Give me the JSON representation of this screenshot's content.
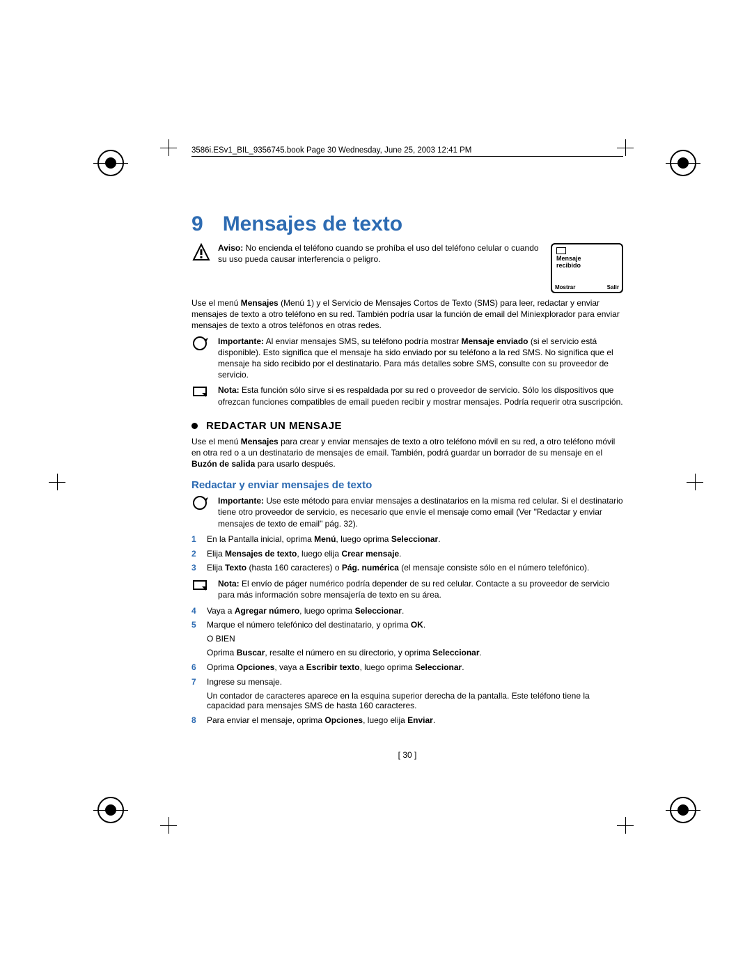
{
  "header": "3586i.ESv1_BIL_9356745.book  Page 30  Wednesday, June 25, 2003  12:41 PM",
  "chapter": {
    "num": "9",
    "title": "Mensajes de texto"
  },
  "aviso": {
    "label": "Aviso:",
    "text": " No encienda el teléfono cuando se prohíba el uso del teléfono celular o cuando su uso pueda causar interferencia o peligro."
  },
  "phone": {
    "line1": "Mensaje",
    "line2": "recibido",
    "left": "Mostrar",
    "right": "Salir"
  },
  "intro1_a": "Use el menú ",
  "intro1_b": "Mensajes",
  "intro1_c": " (Menú 1) y el Servicio de Mensajes Cortos de Texto (SMS) para leer, redactar y enviar mensajes de texto a otro teléfono en su red. También podría usar la función de email del Miniexplorador para enviar mensajes de texto a otros teléfonos en otras redes.",
  "important1_label": "Importante:",
  "important1_a": " Al enviar mensajes SMS, su teléfono podría mostrar ",
  "important1_b": "Mensaje enviado",
  "important1_c": " (si el servicio está disponible). Esto significa que el mensaje ha sido enviado por su teléfono a la red SMS. No significa que el mensaje ha sido recibido por el destinatario. Para más detalles sobre SMS, consulte con su proveedor de servicio.",
  "nota1_label": "Nota:",
  "nota1_text": " Esta función sólo sirve si es respaldada por su red o proveedor de servicio. Sólo los dispositivos que ofrezcan funciones compatibles de email pueden recibir y mostrar mensajes. Podría requerir otra suscripción.",
  "section1": "REDACTAR UN MENSAJE",
  "section1_a": "Use el menú ",
  "section1_b": "Mensajes",
  "section1_c": " para crear y enviar mensajes de texto a otro teléfono móvil en su red, a otro teléfono móvil en otra red o a un destinatario de mensajes de email. También, podrá guardar un borrador de su mensaje en el ",
  "section1_d": "Buzón de salida",
  "section1_e": " para usarlo después.",
  "subsection1": "Redactar y enviar mensajes de texto",
  "important2_label": "Importante:",
  "important2_text": " Use este método para enviar mensajes a destinatarios en la misma red celular. Si el destinatario tiene otro proveedor de servicio, es necesario que envíe el mensaje como email (Ver \"Redactar y enviar mensajes de texto de email\" pág. 32).",
  "steps": {
    "s1_a": "En la Pantalla inicial, oprima ",
    "s1_b": "Menú",
    "s1_c": ", luego oprima ",
    "s1_d": "Seleccionar",
    "s1_e": ".",
    "s2_a": "Elija ",
    "s2_b": "Mensajes de texto",
    "s2_c": ", luego elija ",
    "s2_d": "Crear mensaje",
    "s2_e": ".",
    "s3_a": "Elija ",
    "s3_b": "Texto",
    "s3_c": " (hasta 160 caracteres) o ",
    "s3_d": "Pág. numérica",
    "s3_e": " (el mensaje consiste sólo en el número telefónico).",
    "nota2_label": "Nota:",
    "nota2_text": " El envío de páger numérico podría depender de su red celular. Contacte a su proveedor de servicio para más información sobre mensajería de texto en su área.",
    "s4_a": "Vaya a ",
    "s4_b": "Agregar número",
    "s4_c": ", luego oprima ",
    "s4_d": "Seleccionar",
    "s4_e": ".",
    "s5_a": "Marque el número telefónico del destinatario, y oprima ",
    "s5_b": "OK",
    "s5_c": ".",
    "s5_sub1": "O BIEN",
    "s5_sub2_a": "Oprima ",
    "s5_sub2_b": "Buscar",
    "s5_sub2_c": ", resalte el número en su directorio, y oprima ",
    "s5_sub2_d": "Seleccionar",
    "s5_sub2_e": ".",
    "s6_a": "Oprima ",
    "s6_b": "Opciones",
    "s6_c": ", vaya a ",
    "s6_d": "Escribir texto",
    "s6_e": ", luego oprima ",
    "s6_f": "Seleccionar",
    "s6_g": ".",
    "s7": "Ingrese su mensaje.",
    "s7_sub": "Un contador de caracteres aparece en la esquina superior derecha de la pantalla. Este teléfono tiene la capacidad para mensajes SMS de hasta 160 caracteres.",
    "s8_a": "Para enviar el mensaje, oprima ",
    "s8_b": "Opciones",
    "s8_c": ", luego elija ",
    "s8_d": "Enviar",
    "s8_e": "."
  },
  "pagenum": "[ 30 ]"
}
